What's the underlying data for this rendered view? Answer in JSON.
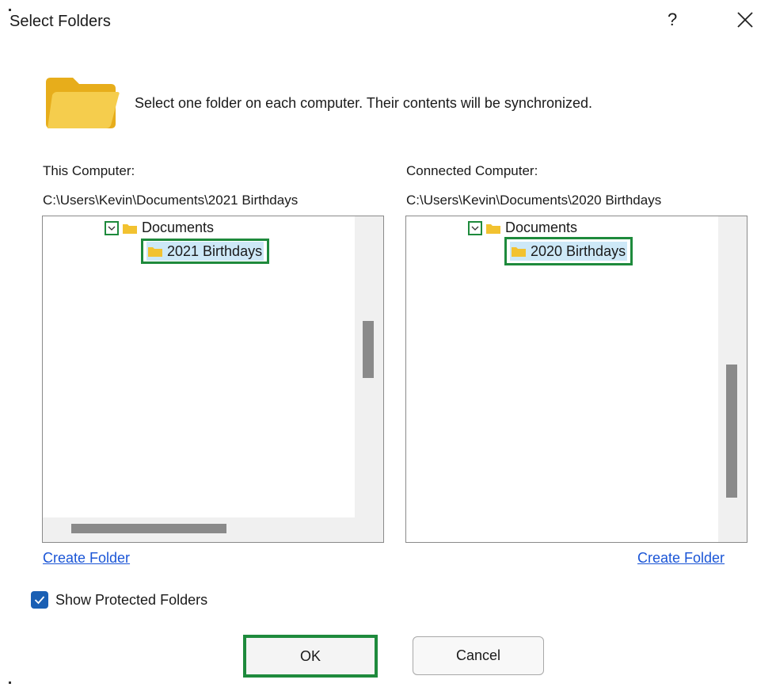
{
  "dialog": {
    "title": "Select Folders",
    "help_glyph": "?",
    "description": "Select one folder on each computer.  Their contents will be synchronized."
  },
  "left": {
    "label": "This Computer:",
    "path": "C:\\Users\\Kevin\\Documents\\2021 Birthdays",
    "tree_parent": "Documents",
    "tree_selected": "2021 Birthdays",
    "create_folder": "Create Folder"
  },
  "right": {
    "label": "Connected Computer:",
    "path": "C:\\Users\\Kevin\\Documents\\2020 Birthdays",
    "tree_parent": "Documents",
    "tree_selected": "2020 Birthdays",
    "create_folder": "Create Folder"
  },
  "options": {
    "show_protected_label": "Show Protected Folders",
    "show_protected_checked": true
  },
  "buttons": {
    "ok": "OK",
    "cancel": "Cancel"
  },
  "colors": {
    "highlight_border": "#1e8a3c",
    "selection_bg": "#cde8f7",
    "link": "#1a55d6",
    "checkbox": "#1a5fb4",
    "folder": "#f2c230"
  }
}
